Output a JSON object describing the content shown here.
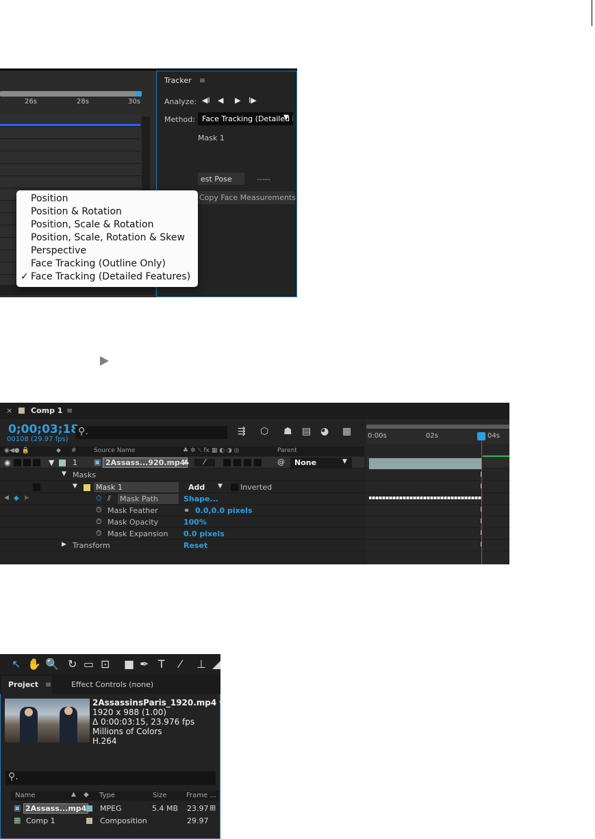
{
  "tracker_panel": {
    "title": "Tracker",
    "menu_icon": "≡",
    "analyze_label": "Analyze:",
    "analyze_icons": [
      "◀I",
      "◀",
      "▶",
      "I▶"
    ],
    "method_label": "Method:",
    "method_value": "Face Tracking (Detailed Features)",
    "mask_label": "Mask 1",
    "best_pose_label": "est Pose",
    "best_pose_value": "-----",
    "copy_face_label": "Copy Face Measurements",
    "timeline_ticks": [
      "26s",
      "28s",
      "30s"
    ],
    "method_options": [
      {
        "label": "Position",
        "checked": false
      },
      {
        "label": "Position & Rotation",
        "checked": false
      },
      {
        "label": "Position, Scale & Rotation",
        "checked": false
      },
      {
        "label": "Position, Scale, Rotation & Skew",
        "checked": false
      },
      {
        "label": "Perspective",
        "checked": false
      },
      {
        "label": "Face Tracking (Outline Only)",
        "checked": false
      },
      {
        "label": "Face Tracking (Detailed Features)",
        "checked": true
      }
    ],
    "check_glyph": "✓"
  },
  "comp_panel": {
    "close_glyph": "×",
    "title": "Comp 1",
    "menu_icon": "≡",
    "timecode": "0;00;03;18",
    "frame_info": "00108 (29.97 fps)",
    "search_glyph": "⚲.",
    "columns": {
      "number": "#",
      "source_name": "Source Name",
      "parent": "Parent"
    },
    "layer": {
      "index": "1",
      "name": "2Assass...920.mp4",
      "parent": "None"
    },
    "rows": {
      "masks": "Masks",
      "mask1": "Mask 1",
      "mode": "Add",
      "inverted": "Inverted",
      "mask_path": "Mask Path",
      "mask_path_value": "Shape...",
      "mask_feather": "Mask Feather",
      "mask_feather_value": "0.0,0.0 pixels",
      "mask_opacity": "Mask Opacity",
      "mask_opacity_value": "100%",
      "mask_expansion": "Mask Expansion",
      "mask_expansion_value": "0.0 pixels",
      "transform": "Transform",
      "transform_value": "Reset"
    },
    "ruler_ticks": [
      "0:00s",
      "02s",
      "04s"
    ],
    "ibeam_glyph": "I"
  },
  "project_panel": {
    "tabs": {
      "project": "Project",
      "project_menu": "≡",
      "effect_controls": "Effect Controls (none)"
    },
    "selected_file": {
      "name": "2AssassinsParis_1920.mp4 ▾",
      "dimensions": "1920 x 988 (1.00)",
      "duration": "Δ 0:00:03:15, 23.976 fps",
      "colors": "Millions of Colors",
      "codec": "H.264"
    },
    "search_glyph": "⚲.",
    "columns": {
      "name": "Name",
      "type": "Type",
      "size": "Size",
      "frame": "Frame ..."
    },
    "items": [
      {
        "name": "2Assass...mp4",
        "type": "MPEG",
        "size": "5.4 MB",
        "frame": "23.97"
      },
      {
        "name": "Comp 1",
        "type": "Composition",
        "size": "",
        "frame": "29.97"
      }
    ],
    "colors": {
      "mpeg_swatch": "#7fb7c4",
      "comp_swatch": "#c8b89c"
    }
  },
  "accent_color": "#2d9fe0"
}
